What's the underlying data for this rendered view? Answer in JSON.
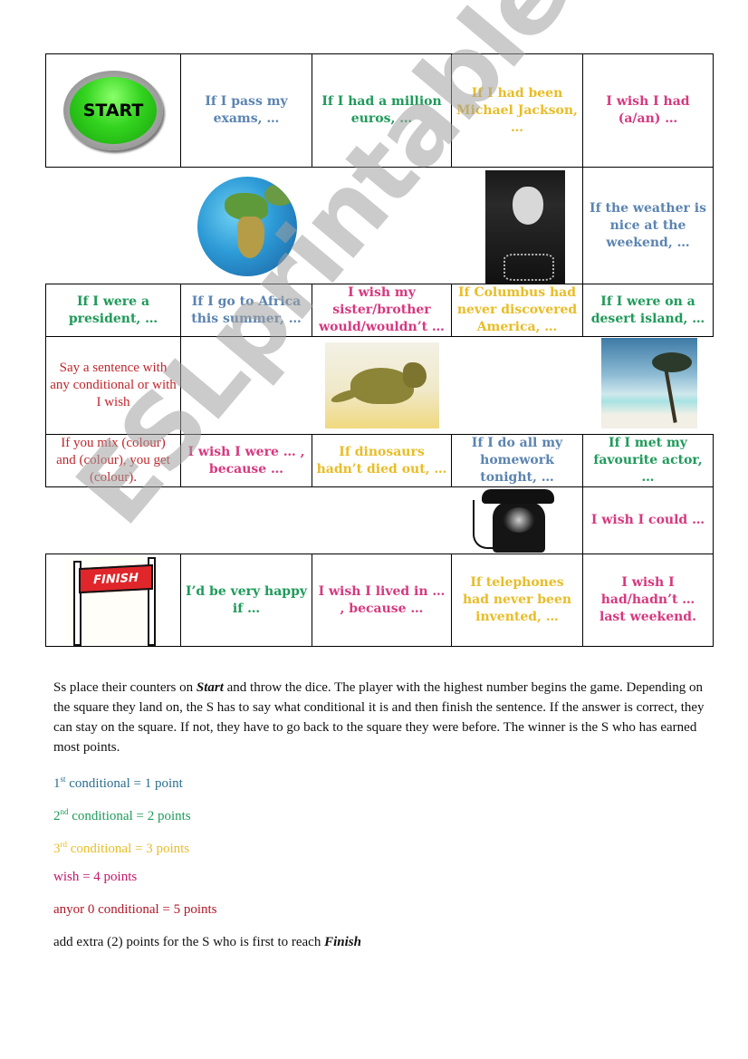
{
  "board": {
    "row1": {
      "start_label": "START",
      "cells": [
        {
          "text": "If I pass my exams, …",
          "color": "blue"
        },
        {
          "text": "If I had a million euros, …",
          "color": "green"
        },
        {
          "text": "If I had been Michael Jackson, …",
          "color": "yellow"
        },
        {
          "text": "I wish I had (a/an) …",
          "color": "pink"
        }
      ]
    },
    "row2": {
      "images": [
        "globe",
        "michael-jackson-photo"
      ],
      "cell": {
        "text": "If the weather is nice at the weekend, …",
        "color": "blue"
      }
    },
    "row3": {
      "cells": [
        {
          "text": "If I were a president, …",
          "color": "green"
        },
        {
          "text": "If I go to Africa this summer, …",
          "color": "blue"
        },
        {
          "text": "I wish my sister/brother would/wouldn’t …",
          "color": "pink"
        },
        {
          "text": "If Columbus had never discovered America, …",
          "color": "yellow"
        },
        {
          "text": "If I were on a desert island, …",
          "color": "green"
        }
      ]
    },
    "row4": {
      "cell": {
        "text": "Say a sentence with any conditional or with I wish",
        "color": "red"
      },
      "images": [
        "dinosaur",
        "beach-palm"
      ]
    },
    "row5": {
      "cells": [
        {
          "text": "If you mix (colour) and (colour), you get (colour).",
          "color": "red"
        },
        {
          "text": "I wish I were … , because …",
          "color": "pink"
        },
        {
          "text": "If dinosaurs hadn’t died out, …",
          "color": "yellow"
        },
        {
          "text": "If I do all my homework tonight, …",
          "color": "blue"
        },
        {
          "text": "If I met my favourite actor, …",
          "color": "green"
        }
      ]
    },
    "row6": {
      "images": [
        "telephone"
      ],
      "cell": {
        "text": "I wish I could …",
        "color": "pink"
      }
    },
    "row7": {
      "finish_label": "FINISH",
      "cells": [
        {
          "text": "I’d be very happy if …",
          "color": "green"
        },
        {
          "text": "I wish I lived in … , because …",
          "color": "pink"
        },
        {
          "text": "If telephones had never been invented, …",
          "color": "yellow"
        },
        {
          "text": "I wish I had/hadn’t … last weekend.",
          "color": "pink"
        }
      ]
    }
  },
  "watermark": "ESLprintables.com",
  "instructions": {
    "p1_before": "Ss place their counters on ",
    "p1_bold": "Start",
    "p1_after": " and throw the dice. The player with the highest number begins the game. Depending on the square they land on, the S has to say what conditional it is and then finish the sentence. If the answer is correct, they can stay on the square. If not, they have to go back to the square they were before. The winner is the S who has earned most points."
  },
  "scoring": {
    "first": {
      "num": "1",
      "sup": "st",
      "text": " conditional = 1 point"
    },
    "second": {
      "num": "2",
      "sup": "nd",
      "text": " conditional = 2 points"
    },
    "third": {
      "num": "3",
      "sup": "rd",
      "text": " conditional = 3 points"
    },
    "wish": "wish = 4 points",
    "zero": "anyor 0 conditional = 5 points",
    "extra_before": "add extra (2) points for the S who is first to reach ",
    "extra_bold": "Finish"
  },
  "colors": {
    "blue": "#5b84b1",
    "green": "#1f9a5a",
    "yellow": "#e8bd28",
    "pink": "#d6397f",
    "red": "#c0262c"
  }
}
